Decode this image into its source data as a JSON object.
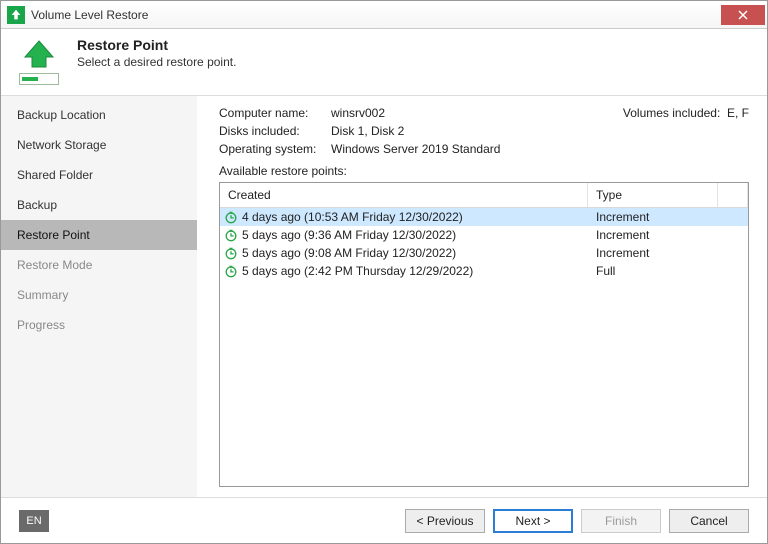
{
  "window": {
    "title": "Volume Level Restore"
  },
  "header": {
    "title": "Restore Point",
    "subtitle": "Select a desired restore point."
  },
  "sidebar": {
    "steps": [
      {
        "label": "Backup Location",
        "state": "done"
      },
      {
        "label": "Network Storage",
        "state": "done"
      },
      {
        "label": "Shared Folder",
        "state": "done"
      },
      {
        "label": "Backup",
        "state": "done"
      },
      {
        "label": "Restore Point",
        "state": "active"
      },
      {
        "label": "Restore Mode",
        "state": "disabled"
      },
      {
        "label": "Summary",
        "state": "disabled"
      },
      {
        "label": "Progress",
        "state": "disabled"
      }
    ]
  },
  "info": {
    "computer_name_label": "Computer name:",
    "computer_name": "winsrv002",
    "disks_label": "Disks included:",
    "disks": "Disk 1, Disk 2",
    "os_label": "Operating system:",
    "os": "Windows Server 2019 Standard",
    "volumes_label": "Volumes included:",
    "volumes": "E, F",
    "available_label": "Available restore points:"
  },
  "list": {
    "headers": {
      "created": "Created",
      "type": "Type"
    },
    "rows": [
      {
        "created": "4 days ago (10:53 AM Friday 12/30/2022)",
        "type": "Increment",
        "selected": true
      },
      {
        "created": "5 days ago (9:36 AM Friday 12/30/2022)",
        "type": "Increment",
        "selected": false
      },
      {
        "created": "5 days ago (9:08 AM Friday 12/30/2022)",
        "type": "Increment",
        "selected": false
      },
      {
        "created": "5 days ago (2:42 PM Thursday 12/29/2022)",
        "type": "Full",
        "selected": false
      }
    ]
  },
  "footer": {
    "language": "EN",
    "previous": "< Previous",
    "next": "Next >",
    "finish": "Finish",
    "cancel": "Cancel"
  }
}
